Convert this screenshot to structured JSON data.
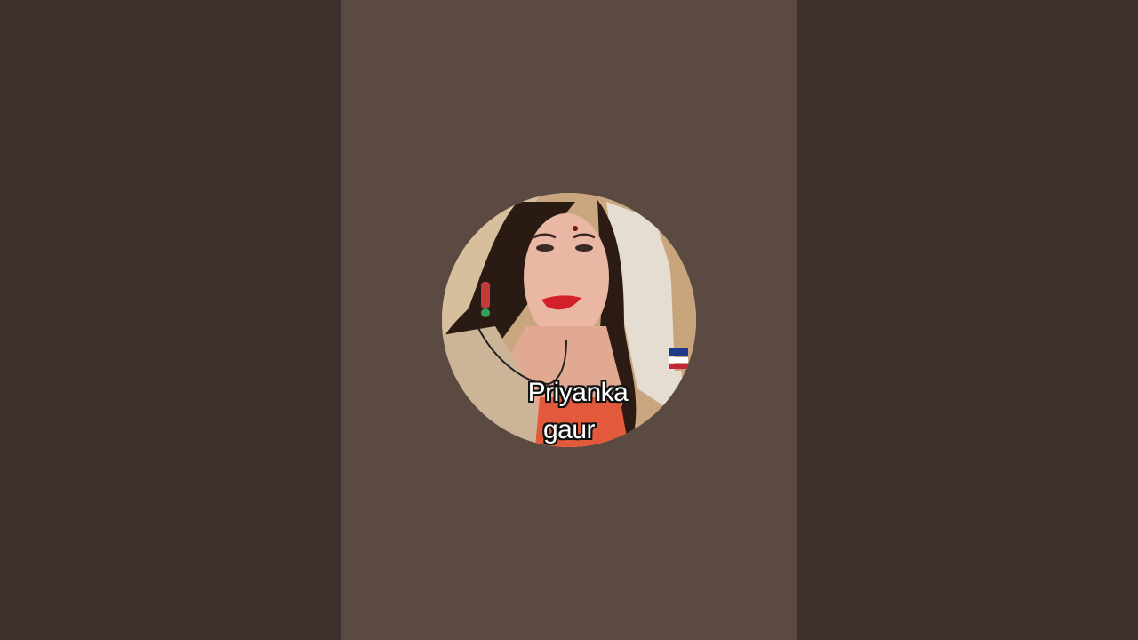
{
  "video": {
    "channel_avatar": {
      "caption_line1": "Priyanka",
      "caption_line2": "gaur"
    }
  },
  "colors": {
    "side_background": "#3e302c",
    "center_background": "#5a4a42",
    "caption_text": "#ffffff",
    "caption_outline": "#111111"
  }
}
